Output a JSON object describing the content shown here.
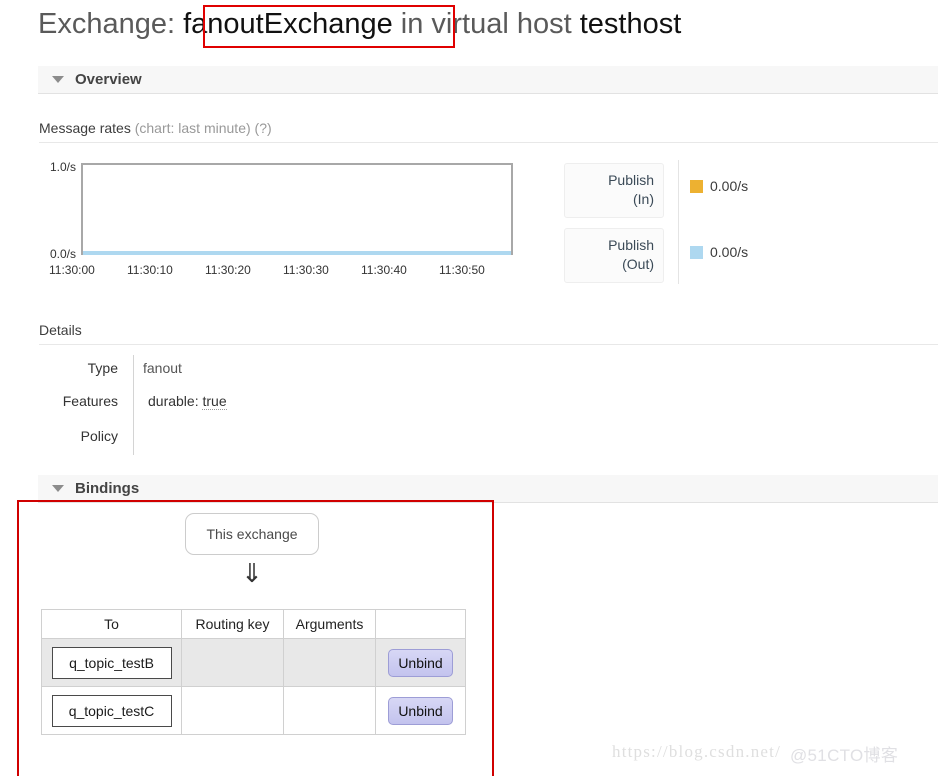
{
  "page": {
    "title_prefix": "Exchange:",
    "exchange_name": "fanoutExchange",
    "title_middle": "in virtual host",
    "vhost": "testhost"
  },
  "overview": {
    "section_title": "Overview",
    "message_rates": {
      "label": "Message rates",
      "sub": "(chart: last minute) (?)"
    }
  },
  "chart_data": {
    "type": "line",
    "title": "Message rates (chart: last minute)",
    "xlabel": "",
    "ylabel": "",
    "ylim": [
      0.0,
      1.0
    ],
    "ytick_labels": [
      "1.0/s",
      "0.0/s"
    ],
    "x": [
      "11:30:00",
      "11:30:10",
      "11:30:20",
      "11:30:30",
      "11:30:40",
      "11:30:50"
    ],
    "series": [
      {
        "name": "Publish (In)",
        "color": "#edb131",
        "current": "0.00/s",
        "values": [
          0,
          0,
          0,
          0,
          0,
          0
        ]
      },
      {
        "name": "Publish (Out)",
        "color": "#aed8f0",
        "current": "0.00/s",
        "values": [
          0,
          0,
          0,
          0,
          0,
          0
        ]
      }
    ],
    "legend_position": "right",
    "grid": false
  },
  "legend": [
    {
      "button_line1": "Publish",
      "button_line2": "(In)",
      "value": "0.00/s",
      "color": "#edb131"
    },
    {
      "button_line1": "Publish",
      "button_line2": "(Out)",
      "value": "0.00/s",
      "color": "#aed8f0"
    }
  ],
  "details": {
    "heading": "Details",
    "rows": [
      {
        "label": "Type",
        "value": "fanout",
        "dotted": false
      },
      {
        "label": "Features",
        "value_prefix": "durable:",
        "value_dotted": "true"
      },
      {
        "label": "Policy",
        "value": "",
        "dotted": false
      }
    ]
  },
  "bindings": {
    "section_title": "Bindings",
    "this_exchange": "This exchange",
    "arrow": "⇓",
    "columns": [
      "To",
      "Routing key",
      "Arguments",
      ""
    ],
    "rows": [
      {
        "to": "q_topic_testB",
        "routing_key": "",
        "arguments": "",
        "action": "Unbind",
        "hover": true
      },
      {
        "to": "q_topic_testC",
        "routing_key": "",
        "arguments": "",
        "action": "Unbind",
        "hover": false
      }
    ]
  },
  "watermark": {
    "url": "https://blog.csdn.net/",
    "handle": "@51CTO博客"
  }
}
